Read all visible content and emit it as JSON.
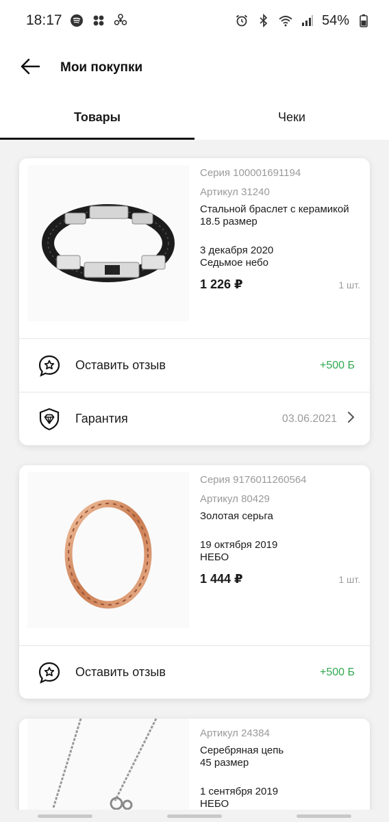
{
  "status_bar": {
    "time": "18:17",
    "battery": "54%",
    "icons_left": [
      "spotify-icon",
      "app-dots-icon",
      "fan-icon"
    ],
    "icons_right": [
      "alarm-icon",
      "bluetooth-icon",
      "wifi-icon",
      "signal-icon",
      "battery-icon"
    ]
  },
  "header": {
    "title": "Мои покупки",
    "back_icon": "arrow-left-icon"
  },
  "tabs": [
    {
      "label": "Товары",
      "active": true
    },
    {
      "label": "Чеки",
      "active": false
    }
  ],
  "purchases": [
    {
      "series": "Серия 100001691194",
      "article": "Артикул 31240",
      "name_line1": "Стальной браслет с керамикой",
      "name_line2": "18.5 размер",
      "date": "3 декабря 2020",
      "store": "Седьмое небо",
      "price": "1 226 ₽",
      "qty": "1 шт.",
      "review_label": "Оставить отзыв",
      "review_bonus": "+500 Б",
      "warranty_label": "Гарантия",
      "warranty_date": "03.06.2021"
    },
    {
      "series": "Серия 9176011260564",
      "article": "Артикул 80429",
      "name_line1": "Золотая серьга",
      "date": "19 октября 2019",
      "store": "НЕБО",
      "price": "1 444 ₽",
      "qty": "1 шт.",
      "review_label": "Оставить отзыв",
      "review_bonus": "+500 Б"
    },
    {
      "article": "Артикул 24384",
      "name_line1": "Серебряная цепь",
      "name_line2": "45 размер",
      "date": "1 сентября 2019",
      "store": "НЕБО"
    }
  ],
  "colors": {
    "accent_green": "#2fa84f",
    "muted_text": "#9a9a9a",
    "background": "#f2f2f2"
  }
}
